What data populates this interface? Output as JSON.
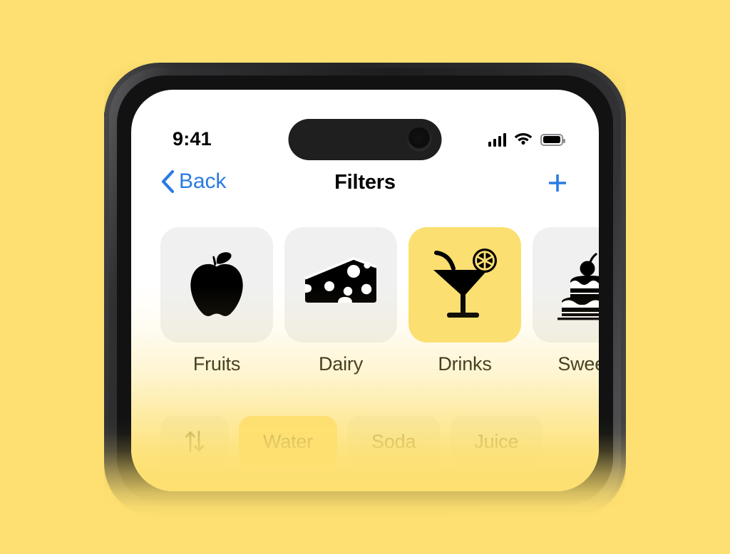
{
  "background": {
    "color": "#FDE071"
  },
  "device": {
    "name": "iphone-14-pro",
    "frame_color": "#2a2a2c",
    "buttons": [
      "silent-switch",
      "volume-up",
      "volume-down",
      "power"
    ]
  },
  "status_bar": {
    "time": "9:41",
    "signal_icon": "cellular-signal-icon",
    "signal_bars_filled": 4,
    "wifi_icon": "wifi-icon",
    "battery_icon": "battery-icon",
    "battery_full": true
  },
  "nav_bar": {
    "back_label": "Back",
    "back_icon": "chevron-left-icon",
    "title": "Filters",
    "add_icon": "plus-icon",
    "accent_color": "#2A7BE4"
  },
  "categories": {
    "selected_color": "#FCDF71",
    "unselected_color": "#F0F0F0",
    "items": [
      {
        "label": "Fruits",
        "icon": "apple-icon",
        "selected": false
      },
      {
        "label": "Dairy",
        "icon": "cheese-icon",
        "selected": false
      },
      {
        "label": "Drinks",
        "icon": "cocktail-icon",
        "selected": true
      },
      {
        "label": "Sweets",
        "icon": "cake-icon",
        "selected": false
      }
    ]
  },
  "chips": {
    "selected_color": "#FCDF71",
    "unselected_color": "#ECECEC",
    "items": [
      {
        "label": "",
        "icon": "sort-arrows-icon",
        "selected": false
      },
      {
        "label": "Water",
        "icon": "",
        "selected": true
      },
      {
        "label": "Soda",
        "icon": "",
        "selected": false
      },
      {
        "label": "Juice",
        "icon": "",
        "selected": false
      }
    ]
  }
}
